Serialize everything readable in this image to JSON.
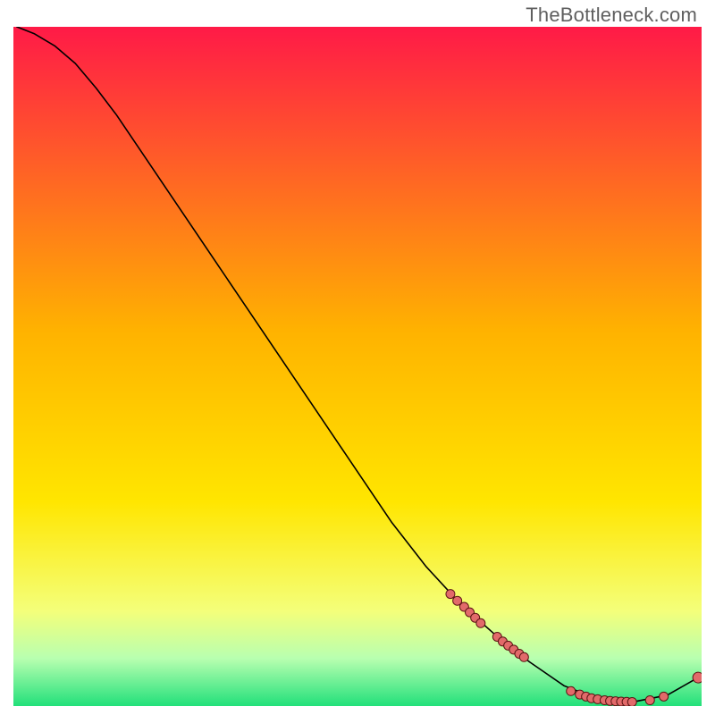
{
  "watermark": "TheBottleneck.com",
  "chart_data": {
    "type": "line",
    "title": "",
    "xlabel": "",
    "ylabel": "",
    "xlim": [
      0,
      100
    ],
    "ylim": [
      0,
      100
    ],
    "background_gradient": {
      "stops": [
        {
          "offset": 0,
          "color": "#ff1a47"
        },
        {
          "offset": 45,
          "color": "#ffb300"
        },
        {
          "offset": 70,
          "color": "#ffe600"
        },
        {
          "offset": 86,
          "color": "#f4ff7a"
        },
        {
          "offset": 93,
          "color": "#b8ffb0"
        },
        {
          "offset": 100,
          "color": "#22e07a"
        }
      ]
    },
    "curve": [
      {
        "x": 0.5,
        "y": 100
      },
      {
        "x": 3,
        "y": 99
      },
      {
        "x": 6,
        "y": 97.2
      },
      {
        "x": 9,
        "y": 94.6
      },
      {
        "x": 12,
        "y": 91
      },
      {
        "x": 15,
        "y": 87
      },
      {
        "x": 20,
        "y": 79.5
      },
      {
        "x": 25,
        "y": 72
      },
      {
        "x": 30,
        "y": 64.5
      },
      {
        "x": 35,
        "y": 57
      },
      {
        "x": 40,
        "y": 49.5
      },
      {
        "x": 45,
        "y": 42
      },
      {
        "x": 50,
        "y": 34.5
      },
      {
        "x": 55,
        "y": 27
      },
      {
        "x": 60,
        "y": 20.5
      },
      {
        "x": 65,
        "y": 15
      },
      {
        "x": 70,
        "y": 10.5
      },
      {
        "x": 75,
        "y": 6.5
      },
      {
        "x": 80,
        "y": 3
      },
      {
        "x": 85,
        "y": 1
      },
      {
        "x": 90,
        "y": 0.6
      },
      {
        "x": 95,
        "y": 1.6
      },
      {
        "x": 99.5,
        "y": 4.2
      }
    ],
    "markers": [
      {
        "x": 63.5,
        "y": 16.5,
        "r": 5
      },
      {
        "x": 64.5,
        "y": 15.5,
        "r": 5
      },
      {
        "x": 65.5,
        "y": 14.6,
        "r": 5
      },
      {
        "x": 66.3,
        "y": 13.8,
        "r": 5
      },
      {
        "x": 67.1,
        "y": 13,
        "r": 5
      },
      {
        "x": 67.9,
        "y": 12.2,
        "r": 5
      },
      {
        "x": 70.3,
        "y": 10.2,
        "r": 5
      },
      {
        "x": 71.1,
        "y": 9.5,
        "r": 5
      },
      {
        "x": 71.9,
        "y": 8.9,
        "r": 5
      },
      {
        "x": 72.7,
        "y": 8.3,
        "r": 5
      },
      {
        "x": 73.5,
        "y": 7.7,
        "r": 5
      },
      {
        "x": 74.2,
        "y": 7.2,
        "r": 5
      },
      {
        "x": 81,
        "y": 2.2,
        "r": 5
      },
      {
        "x": 82.3,
        "y": 1.7,
        "r": 5
      },
      {
        "x": 83.2,
        "y": 1.4,
        "r": 5
      },
      {
        "x": 84,
        "y": 1.15,
        "r": 5
      },
      {
        "x": 84.9,
        "y": 1,
        "r": 5
      },
      {
        "x": 85.9,
        "y": 0.85,
        "r": 5
      },
      {
        "x": 86.7,
        "y": 0.75,
        "r": 5
      },
      {
        "x": 87.5,
        "y": 0.7,
        "r": 5
      },
      {
        "x": 88.3,
        "y": 0.65,
        "r": 5
      },
      {
        "x": 89.1,
        "y": 0.62,
        "r": 5
      },
      {
        "x": 89.9,
        "y": 0.6,
        "r": 5
      },
      {
        "x": 92.5,
        "y": 0.85,
        "r": 5
      },
      {
        "x": 94.5,
        "y": 1.4,
        "r": 5
      },
      {
        "x": 99.5,
        "y": 4.2,
        "r": 6
      }
    ],
    "marker_style": {
      "fill": "#e26a6a",
      "stroke": "#5c1414"
    },
    "curve_style": {
      "stroke": "#000000",
      "width": 1.6
    }
  }
}
